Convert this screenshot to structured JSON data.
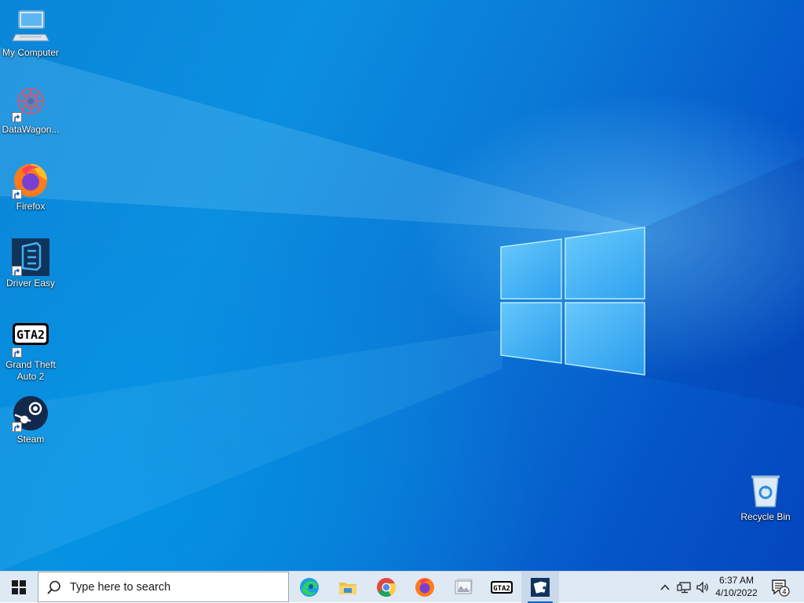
{
  "desktop": {
    "icons": [
      {
        "label": "My Computer",
        "icon": "computer-icon"
      },
      {
        "label": "DataWagon...",
        "icon": "datawagon-icon"
      },
      {
        "label": "Firefox",
        "icon": "firefox-icon"
      },
      {
        "label": "Driver Easy",
        "icon": "driver-easy-icon"
      },
      {
        "label": "Grand Theft Auto 2",
        "icon": "gta2-icon"
      },
      {
        "label": "Steam",
        "icon": "steam-icon"
      },
      {
        "label": "Recycle Bin",
        "icon": "recycle-bin-icon"
      }
    ]
  },
  "taskbar": {
    "start_icon": "windows-start-icon",
    "search": {
      "placeholder": "Type here to search",
      "icon": "search-icon"
    },
    "pinned": [
      {
        "name": "Microsoft Edge",
        "icon": "edge-icon"
      },
      {
        "name": "File Explorer",
        "icon": "file-explorer-icon"
      },
      {
        "name": "Google Chrome",
        "icon": "chrome-icon"
      },
      {
        "name": "Firefox",
        "icon": "firefox-icon"
      },
      {
        "name": "Photos",
        "icon": "photo-viewer-icon"
      },
      {
        "name": "Grand Theft Auto 2",
        "icon": "gta2-icon"
      },
      {
        "name": "Solitaire",
        "icon": "solitaire-icon",
        "active": true
      }
    ],
    "tray": {
      "chevron_icon": "chevron-up-icon",
      "network_icon": "network-icon",
      "volume_icon": "volume-icon",
      "time": "6:37 AM",
      "date": "4/10/2022",
      "notification_icon": "notification-icon",
      "notification_count": "4"
    }
  },
  "colors": {
    "taskbar_bg": "#dfe9f3",
    "wallpaper_dark": "#0446bd",
    "wallpaper_light": "#0b8fe0",
    "active_indicator": "#0a64c8"
  }
}
